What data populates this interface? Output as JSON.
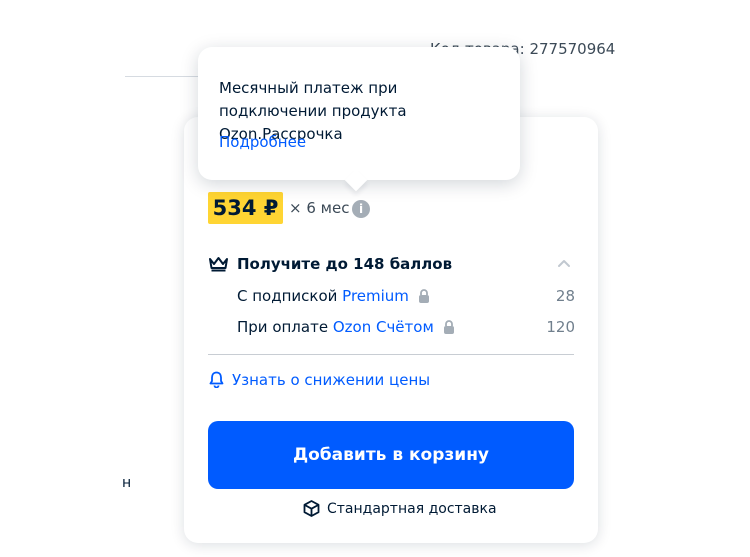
{
  "product": {
    "code": "Код товара: 277570964"
  },
  "cutoff_text": "н",
  "tooltip": {
    "text": "Месячный платеж при подключении продукта Ozon.Рассрочка",
    "link": "Подробнее"
  },
  "installment": {
    "price": "534 ₽",
    "months": "× 6 мес",
    "info_icon": "i"
  },
  "points": {
    "title": "Получите до 148 баллов",
    "rows": [
      {
        "prefix": "С подпиской",
        "accent": "Premium",
        "value": "28"
      },
      {
        "prefix": "При оплате",
        "accent": "Ozon Счётом",
        "value": "120"
      }
    ]
  },
  "price_alert": "Узнать о снижении цены",
  "add_to_cart": "Добавить в корзину",
  "delivery": "Стандартная доставка",
  "colors": {
    "accent_blue": "#005bff",
    "price_yellow": "#ffd533",
    "text_dark": "#001a34",
    "text_muted": "#707f8d"
  }
}
